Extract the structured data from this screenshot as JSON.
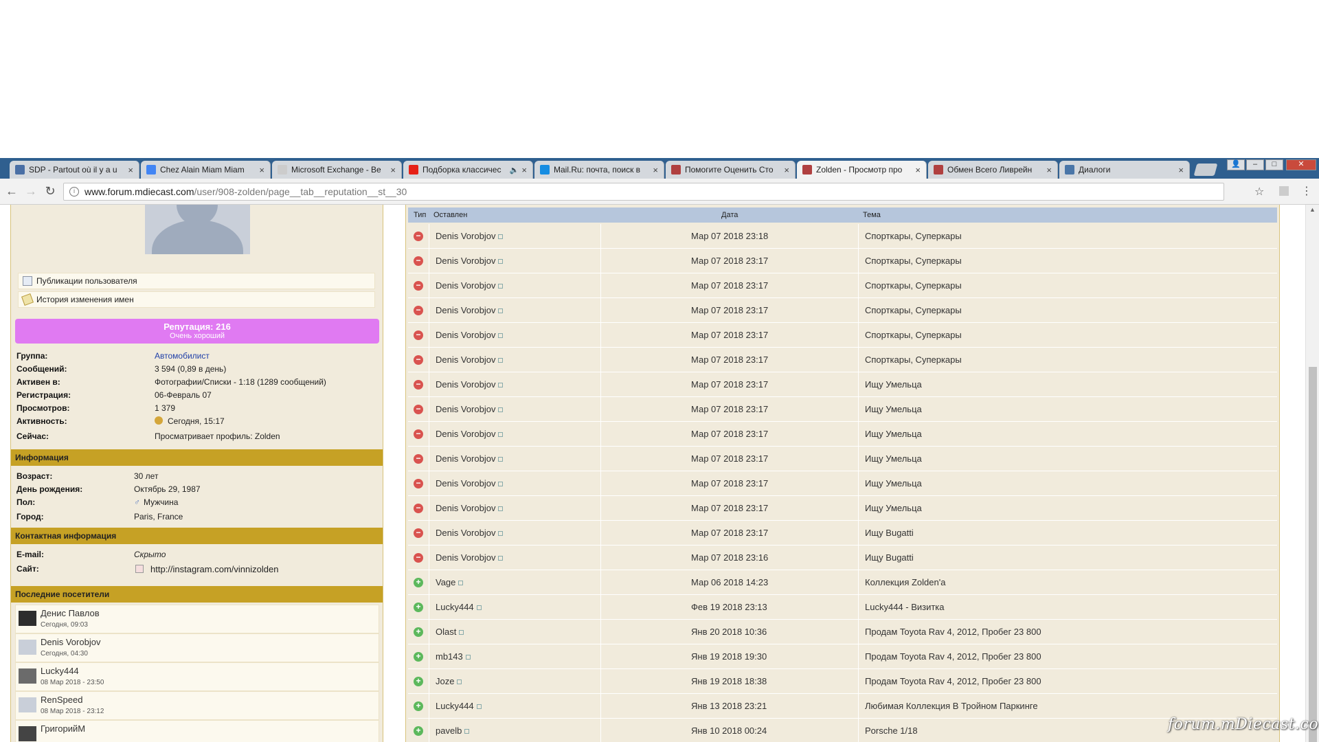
{
  "browser": {
    "tabs": [
      {
        "title": "SDP - Partout où il y a u",
        "color": "#4a6fa5"
      },
      {
        "title": "Chez Alain Miam Miam",
        "color": "#4285f4"
      },
      {
        "title": "Microsoft Exchange - Be",
        "color": "#cccccc"
      },
      {
        "title": "Подборка классичес",
        "color": "#e62117",
        "sound": "🔈"
      },
      {
        "title": "Mail.Ru: почта, поиск в",
        "color": "#168de2"
      },
      {
        "title": "Помогите Оценить Сто",
        "color": "#b04040"
      },
      {
        "title": "Zolden - Просмотр про",
        "color": "#b04040"
      },
      {
        "title": "Обмен Всего Ливрейн",
        "color": "#b04040"
      },
      {
        "title": "Диалоги",
        "color": "#4a76a8"
      }
    ],
    "url_host": "www.forum.mdiecast.com",
    "url_path": "/user/908-zolden/page__tab__reputation__st__30"
  },
  "profile": {
    "links": [
      "Публикации пользователя",
      "История изменения имен"
    ],
    "reputation_title": "Репутация: 216",
    "reputation_sub": "Очень хороший",
    "fields": [
      {
        "k": "Группа:",
        "v": "Автомобилист",
        "link": true
      },
      {
        "k": "Сообщений:",
        "v": "3 594 (0,89 в день)"
      },
      {
        "k": "Активен в:",
        "v": "Фотографии/Списки - 1:18 (1289 сообщений)"
      },
      {
        "k": "Регистрация:",
        "v": "06-Февраль 07"
      },
      {
        "k": "Просмотров:",
        "v": "1 379"
      },
      {
        "k": "Активность:",
        "v": "Сегодня, 15:17"
      },
      {
        "k": "Сейчас:",
        "v": "Просматривает профиль: Zolden"
      }
    ],
    "info_header": "Информация",
    "info": [
      {
        "k": "Возраст:",
        "v": "30 лет"
      },
      {
        "k": "День рождения:",
        "v": "Октябрь 29, 1987"
      },
      {
        "k": "Пол:",
        "v": "Мужчина"
      },
      {
        "k": "Город:",
        "v": "Paris, France"
      }
    ],
    "contact_header": "Контактная информация",
    "contact": [
      {
        "k": "E-mail:",
        "v": "Скрыто"
      },
      {
        "k": "Сайт:",
        "v": "http://instagram.com/vinnizolden"
      }
    ],
    "visitors_header": "Последние посетители",
    "visitors": [
      {
        "name": "Денис Павлов",
        "time": "Сегодня, 09:03"
      },
      {
        "name": "Denis Vorobjov",
        "time": "Сегодня, 04:30"
      },
      {
        "name": "Lucky444",
        "time": "08 Мар 2018 - 23:50"
      },
      {
        "name": "RenSpeed",
        "time": "08 Мар 2018 - 23:12"
      },
      {
        "name": "ГригорийМ",
        "time": ""
      }
    ]
  },
  "table": {
    "headers": {
      "type": "Тип",
      "left_by": "Оставлен",
      "date": "Дата",
      "topic": "Тема"
    },
    "rows": [
      {
        "sign": "neg",
        "user": "Denis Vorobjov",
        "date": "Мар 07 2018 23:18",
        "topic": "Спорткары, Суперкары"
      },
      {
        "sign": "neg",
        "user": "Denis Vorobjov",
        "date": "Мар 07 2018 23:17",
        "topic": "Спорткары, Суперкары"
      },
      {
        "sign": "neg",
        "user": "Denis Vorobjov",
        "date": "Мар 07 2018 23:17",
        "topic": "Спорткары, Суперкары"
      },
      {
        "sign": "neg",
        "user": "Denis Vorobjov",
        "date": "Мар 07 2018 23:17",
        "topic": "Спорткары, Суперкары"
      },
      {
        "sign": "neg",
        "user": "Denis Vorobjov",
        "date": "Мар 07 2018 23:17",
        "topic": "Спорткары, Суперкары"
      },
      {
        "sign": "neg",
        "user": "Denis Vorobjov",
        "date": "Мар 07 2018 23:17",
        "topic": "Спорткары, Суперкары"
      },
      {
        "sign": "neg",
        "user": "Denis Vorobjov",
        "date": "Мар 07 2018 23:17",
        "topic": "Ищу Умельца"
      },
      {
        "sign": "neg",
        "user": "Denis Vorobjov",
        "date": "Мар 07 2018 23:17",
        "topic": "Ищу Умельца"
      },
      {
        "sign": "neg",
        "user": "Denis Vorobjov",
        "date": "Мар 07 2018 23:17",
        "topic": "Ищу Умельца"
      },
      {
        "sign": "neg",
        "user": "Denis Vorobjov",
        "date": "Мар 07 2018 23:17",
        "topic": "Ищу Умельца"
      },
      {
        "sign": "neg",
        "user": "Denis Vorobjov",
        "date": "Мар 07 2018 23:17",
        "topic": "Ищу Умельца"
      },
      {
        "sign": "neg",
        "user": "Denis Vorobjov",
        "date": "Мар 07 2018 23:17",
        "topic": "Ищу Умельца"
      },
      {
        "sign": "neg",
        "user": "Denis Vorobjov",
        "date": "Мар 07 2018 23:17",
        "topic": "Ищу Bugatti"
      },
      {
        "sign": "neg",
        "user": "Denis Vorobjov",
        "date": "Мар 07 2018 23:16",
        "topic": "Ищу Bugatti"
      },
      {
        "sign": "pos",
        "user": "Vage",
        "date": "Мар 06 2018 14:23",
        "topic": "Коллекция Zolden'a"
      },
      {
        "sign": "pos",
        "user": "Lucky444",
        "date": "Фев 19 2018 23:13",
        "topic": "Lucky444 - Визитка"
      },
      {
        "sign": "pos",
        "user": "Olast",
        "date": "Янв 20 2018 10:36",
        "topic": "Продам Toyota Rav 4, 2012, Пробег 23 800"
      },
      {
        "sign": "pos",
        "user": "mb143",
        "date": "Янв 19 2018 19:30",
        "topic": "Продам Toyota Rav 4, 2012, Пробег 23 800"
      },
      {
        "sign": "pos",
        "user": "Joze",
        "date": "Янв 19 2018 18:38",
        "topic": "Продам Toyota Rav 4, 2012, Пробег 23 800"
      },
      {
        "sign": "pos",
        "user": "Lucky444",
        "date": "Янв 13 2018 23:21",
        "topic": "Любимая Коллекция В Тройном Паркинге"
      },
      {
        "sign": "pos",
        "user": "pavelb",
        "date": "Янв 10 2018 00:24",
        "topic": "Porsche 1/18"
      }
    ]
  },
  "watermark": "forum.mDiecast.com"
}
